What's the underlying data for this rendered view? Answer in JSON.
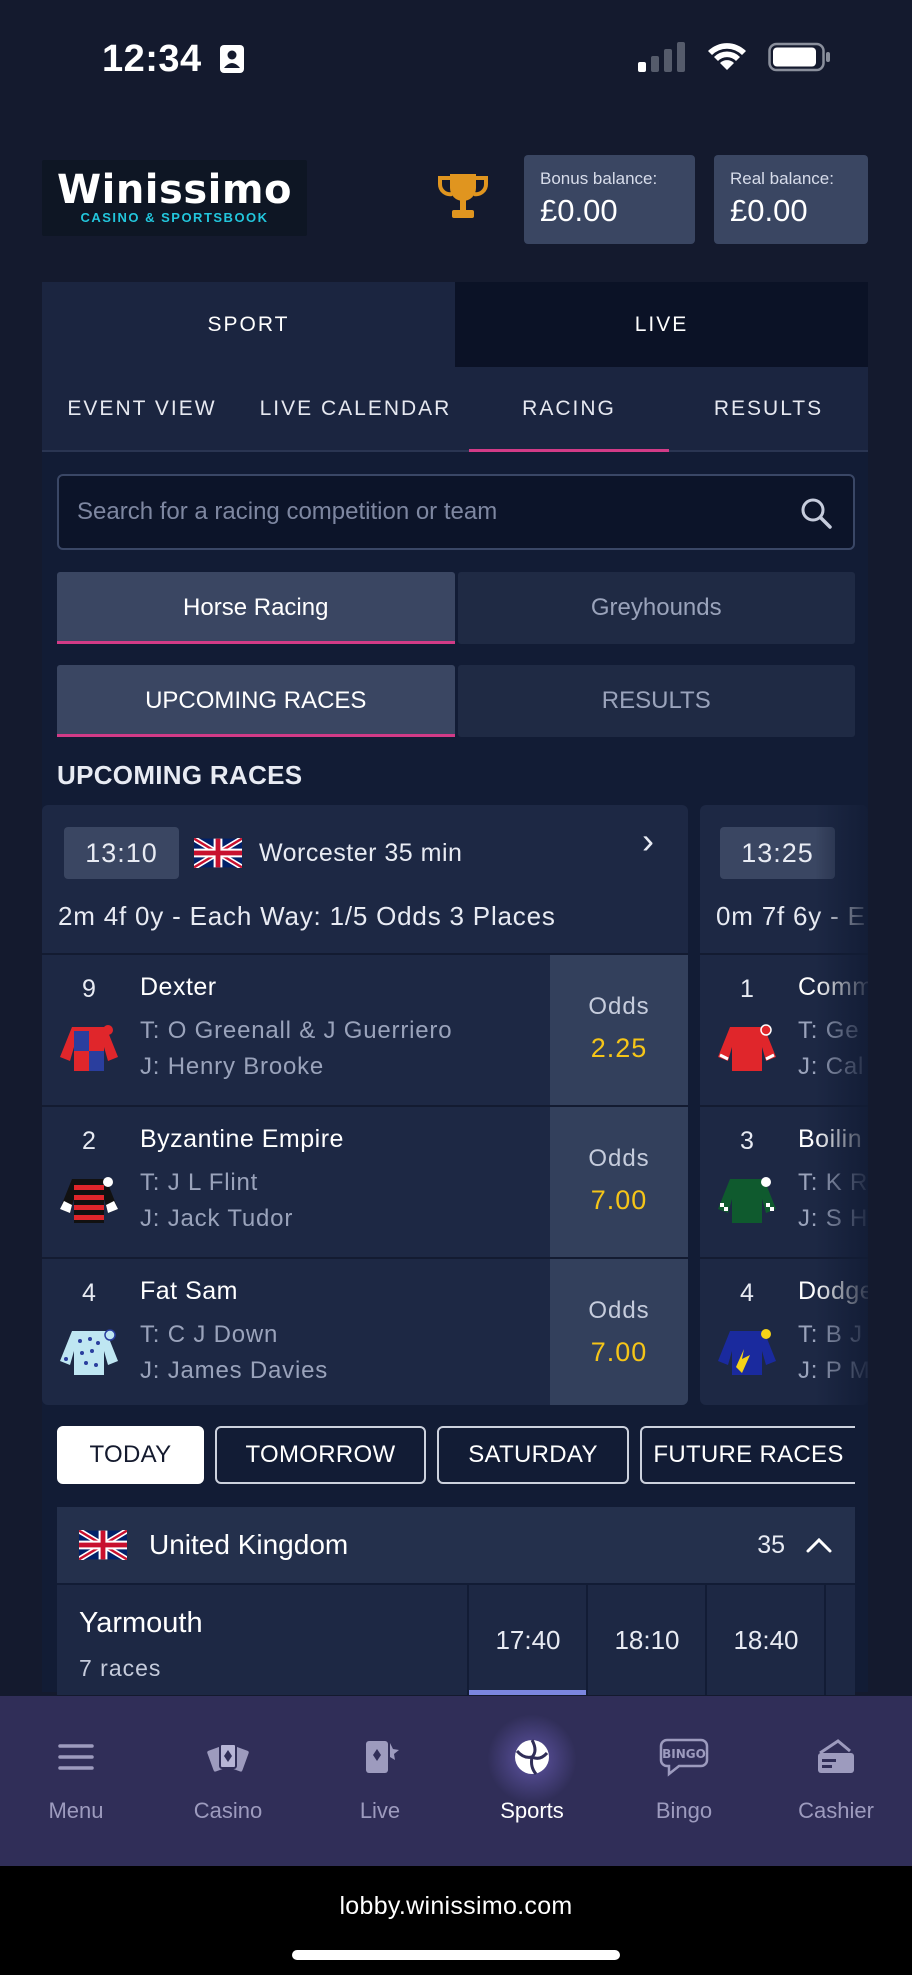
{
  "status_bar": {
    "time": "12:34"
  },
  "header": {
    "logo_text": "Winissimo",
    "logo_subtext": "CASINO & SPORTSBOOK",
    "bonus_balance": {
      "label": "Bonus balance:",
      "value": "£0.00"
    },
    "real_balance": {
      "label": "Real balance:",
      "value": "£0.00"
    }
  },
  "main_tabs": [
    "SPORT",
    "LIVE"
  ],
  "sub_tabs": [
    "EVENT VIEW",
    "LIVE CALENDAR",
    "RACING",
    "RESULTS"
  ],
  "search": {
    "placeholder": "Search for a racing competition or team"
  },
  "sport_toggle": [
    "Horse Racing",
    "Greyhounds"
  ],
  "view_toggle": [
    "UPCOMING RACES",
    "RESULTS"
  ],
  "section_title": "UPCOMING RACES",
  "races": [
    {
      "time": "13:10",
      "venue": "Worcester  35 min",
      "description": "2m 4f 0y - Each Way: 1/5 Odds 3 Places",
      "runners": [
        {
          "num": "9",
          "name": "Dexter",
          "trainer": "T: O Greenall & J Guerriero",
          "jockey": "J: Henry Brooke",
          "odds_label": "Odds",
          "odds": "2.25"
        },
        {
          "num": "2",
          "name": "Byzantine Empire",
          "trainer": "T: J L Flint",
          "jockey": "J: Jack Tudor",
          "odds_label": "Odds",
          "odds": "7.00"
        },
        {
          "num": "4",
          "name": "Fat Sam",
          "trainer": "T: C J Down",
          "jockey": "J: James Davies",
          "odds_label": "Odds",
          "odds": "7.00"
        }
      ]
    },
    {
      "time": "13:25",
      "description": "0m 7f 6y - E",
      "runners": [
        {
          "num": "1",
          "name": "Comm",
          "trainer": "T: Ge",
          "jockey": "J: Cal"
        },
        {
          "num": "3",
          "name": "Boilin",
          "trainer": "T: K R",
          "jockey": "J: S H"
        },
        {
          "num": "4",
          "name": "Dodge",
          "trainer": "T: B J",
          "jockey": "J: P M"
        }
      ]
    }
  ],
  "day_filters": [
    "TODAY",
    "TOMORROW",
    "SATURDAY",
    "FUTURE RACES"
  ],
  "country": {
    "name": "United Kingdom",
    "count": "35"
  },
  "meeting": {
    "name": "Yarmouth",
    "races": "7 races",
    "times": [
      "17:40",
      "18:10",
      "18:40"
    ]
  },
  "bottom_nav": [
    "Menu",
    "Casino",
    "Live",
    "Sports",
    "Bingo",
    "Cashier"
  ],
  "browser": {
    "url": "lobby.winissimo.com"
  },
  "colors": {
    "accent_pink": "#d23b87",
    "odds_yellow": "#f5c518",
    "nav_bg": "#302e58",
    "background": "#141a2e"
  }
}
